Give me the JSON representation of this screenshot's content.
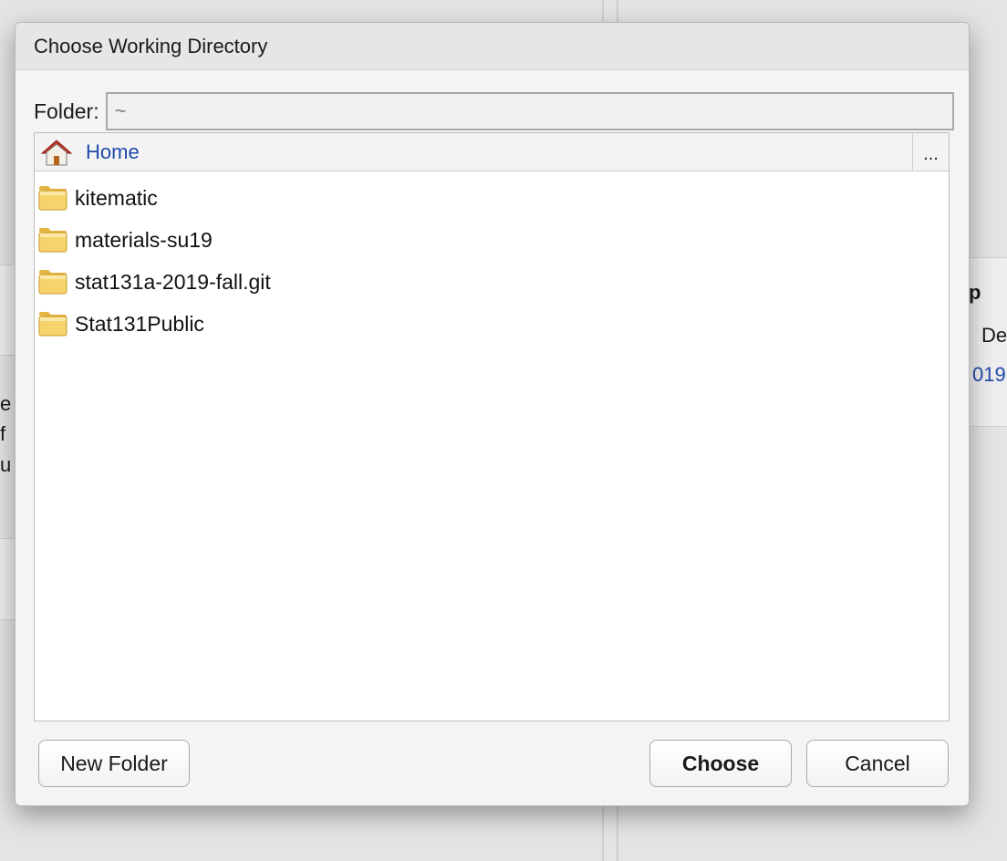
{
  "dialog": {
    "title": "Choose Working Directory",
    "folder_label": "Folder:",
    "folder_value": "~",
    "path": {
      "home_label": "Home",
      "more_label": "..."
    },
    "items": [
      {
        "name": "kitematic",
        "type": "folder"
      },
      {
        "name": "materials-su19",
        "type": "folder"
      },
      {
        "name": "stat131a-2019-fall.git",
        "type": "folder"
      },
      {
        "name": "Stat131Public",
        "type": "folder"
      }
    ],
    "buttons": {
      "new_folder": "New Folder",
      "choose": "Choose",
      "cancel": "Cancel"
    }
  },
  "background": {
    "left_chars": [
      "e",
      "f",
      "u"
    ],
    "right_header": "p",
    "right_col": "De",
    "right_value": "019"
  }
}
